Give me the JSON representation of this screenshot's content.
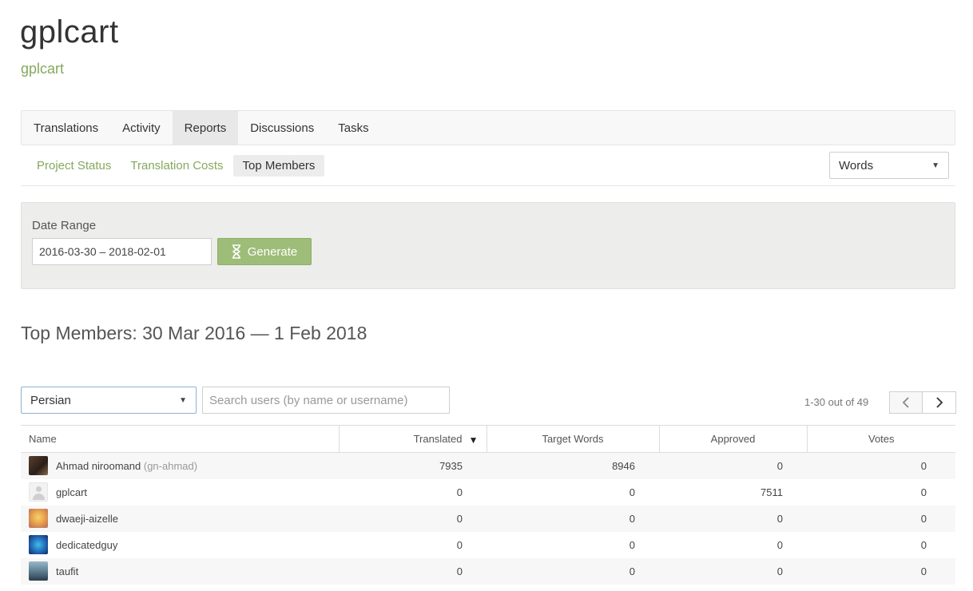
{
  "project": {
    "title": "gplcart",
    "subtitle": "gplcart"
  },
  "main_tabs": [
    {
      "label": "Translations",
      "active": false
    },
    {
      "label": "Activity",
      "active": false
    },
    {
      "label": "Reports",
      "active": true
    },
    {
      "label": "Discussions",
      "active": false
    },
    {
      "label": "Tasks",
      "active": false
    }
  ],
  "sub_tabs": [
    {
      "label": "Project Status",
      "active": false
    },
    {
      "label": "Translation Costs",
      "active": false
    },
    {
      "label": "Top Members",
      "active": true
    }
  ],
  "unit_select": {
    "value": "Words"
  },
  "filters": {
    "date_range_label": "Date Range",
    "date_range_value": "2016-03-30 – 2018-02-01",
    "generate_label": "Generate"
  },
  "report": {
    "heading": "Top Members: 30 Mar 2016 — 1 Feb 2018"
  },
  "language_select": {
    "value": "Persian"
  },
  "search": {
    "placeholder": "Search users (by name or username)"
  },
  "pagination": {
    "info": "1-30 out of 49"
  },
  "table": {
    "columns": [
      "Name",
      "Translated",
      "Target Words",
      "Approved",
      "Votes"
    ],
    "rows": [
      {
        "name": "Ahmad niroomand",
        "username": "(gn-ahmad)",
        "translated": "7935",
        "target_words": "8946",
        "approved": "0",
        "votes": "0"
      },
      {
        "name": "gplcart",
        "username": "",
        "translated": "0",
        "target_words": "0",
        "approved": "7511",
        "votes": "0"
      },
      {
        "name": "dwaeji-aizelle",
        "username": "",
        "translated": "0",
        "target_words": "0",
        "approved": "0",
        "votes": "0"
      },
      {
        "name": "dedicatedguy",
        "username": "",
        "translated": "0",
        "target_words": "0",
        "approved": "0",
        "votes": "0"
      },
      {
        "name": "taufit",
        "username": "",
        "translated": "0",
        "target_words": "0",
        "approved": "0",
        "votes": "0"
      }
    ]
  },
  "colors": {
    "accent_green": "#86a85f",
    "generate_button": "#9ebd79",
    "panel_background": "#ededeb"
  }
}
